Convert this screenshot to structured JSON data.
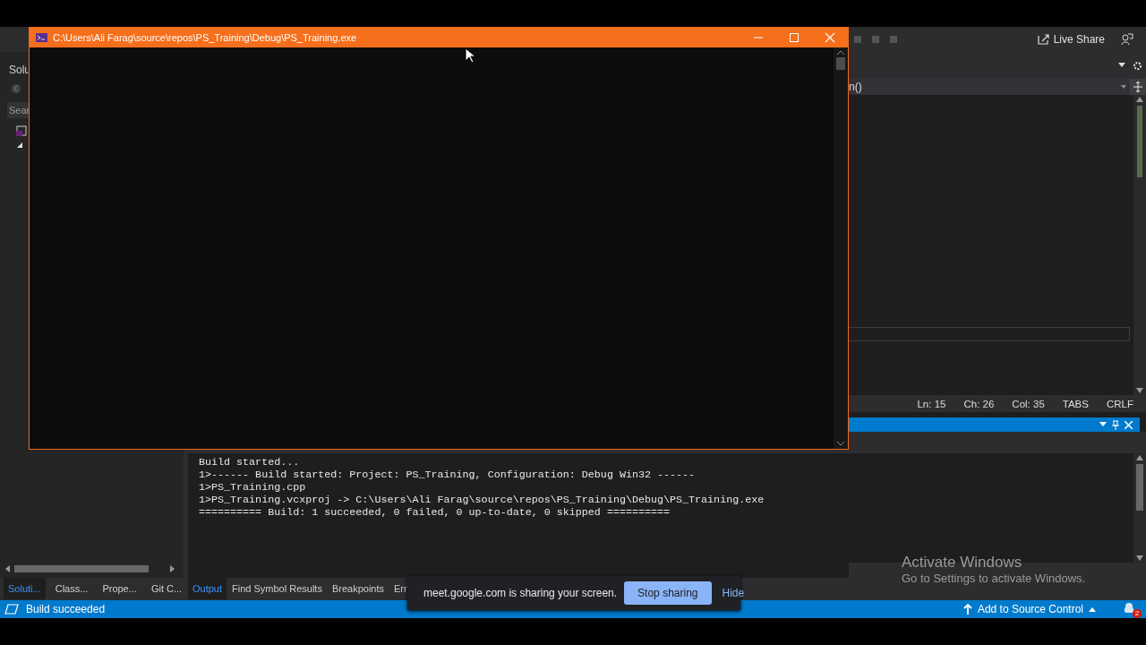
{
  "ide": {
    "toolbar": {
      "live_share": "Live Share"
    },
    "solution_explorer": {
      "title": "Solu",
      "search_placeholder": "Sear"
    },
    "editor": {
      "member_dropdown": "n()",
      "status": [
        "Ln: 15",
        "Ch: 26",
        "Col: 35",
        "TABS",
        "CRLF"
      ]
    },
    "output": {
      "lines": [
        "Build started...",
        "1>------ Build started: Project: PS_Training, Configuration: Debug Win32 ------",
        "1>PS_Training.cpp",
        "1>PS_Training.vcxproj -> C:\\Users\\Ali Farag\\source\\repos\\PS_Training\\Debug\\PS_Training.exe",
        "========== Build: 1 succeeded, 0 failed, 0 up-to-date, 0 skipped =========="
      ]
    },
    "left_tabs": [
      {
        "label": "Soluti...",
        "selected": true
      },
      {
        "label": "Class...",
        "selected": false
      },
      {
        "label": "Prope...",
        "selected": false
      },
      {
        "label": "Git C...",
        "selected": false
      }
    ],
    "bottom_tabs": [
      {
        "label": "Output",
        "selected": true
      },
      {
        "label": "Find Symbol Results",
        "selected": false
      },
      {
        "label": "Breakpoints",
        "selected": false
      },
      {
        "label": "Err",
        "selected": false
      }
    ],
    "status_bar": {
      "message": "Build succeeded",
      "source_control": "Add to Source Control",
      "notifications": "2"
    }
  },
  "console_window": {
    "title": "C:\\Users\\Ali Farag\\source\\repos\\PS_Training\\Debug\\PS_Training.exe"
  },
  "share_bar": {
    "message": "meet.google.com is sharing your screen.",
    "stop": "Stop sharing",
    "hide": "Hide"
  },
  "activation": {
    "title": "Activate Windows",
    "subtitle": "Go to Settings to activate Windows."
  }
}
